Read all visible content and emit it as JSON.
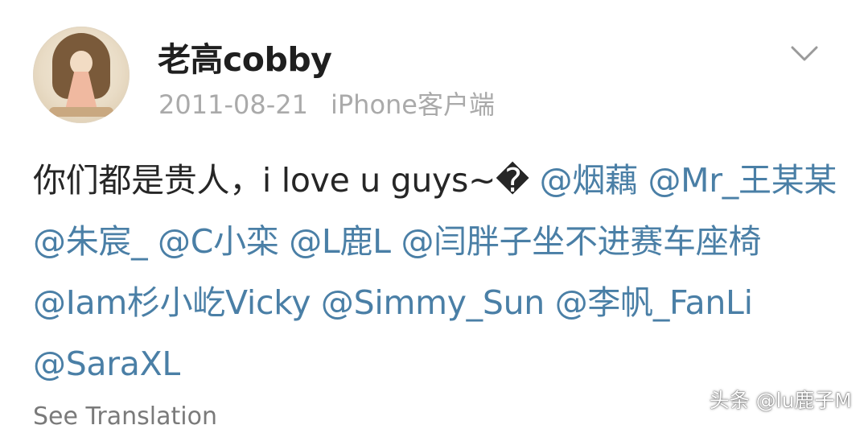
{
  "post": {
    "author": "老高cobby",
    "date": "2011-08-21",
    "client": "iPhone客户端",
    "text_prefix": "你们都是贵人，i love u guys~",
    "emoji_placeholder": "�",
    "mentions": [
      "@烟藕",
      "@Mr_王某某",
      "@朱宸_",
      "@C小栾",
      "@L鹿L",
      "@闫胖子坐不进赛车座椅",
      "@Iam杉小屹Vicky",
      "@Simmy_Sun",
      "@李帆_FanLi",
      "@SaraXL"
    ],
    "see_translation": "See Translation"
  },
  "icons": {
    "avatar": "user-avatar",
    "menu": "chevron-down-icon"
  },
  "watermark": "头条 @lu鹿子M",
  "colors": {
    "mention": "#4a7fa6",
    "meta": "#aaaaaa",
    "text": "#262626"
  }
}
